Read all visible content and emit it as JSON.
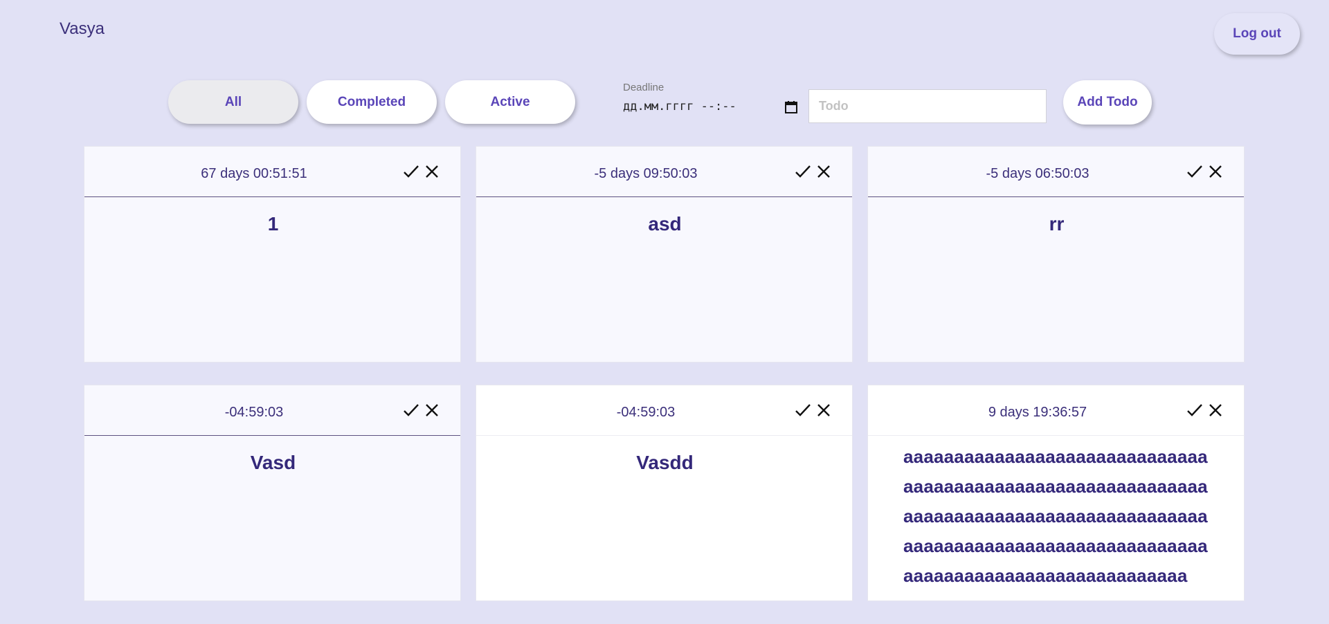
{
  "header": {
    "username": "Vasya",
    "logout_label": "Log out"
  },
  "filters": {
    "all": "All",
    "completed": "Completed",
    "active": "Active",
    "selected": "All"
  },
  "form": {
    "deadline_label": "Deadline",
    "deadline_value": "дд.мм.гггг --:--",
    "todo_placeholder": "Todo",
    "add_label": "Add Todo"
  },
  "todos": [
    {
      "timer": "67 days 00:51:51",
      "title": "1"
    },
    {
      "timer": "-5 days 09:50:03",
      "title": "asd"
    },
    {
      "timer": "-5 days 06:50:03",
      "title": "rr"
    },
    {
      "timer": "-04:59:03",
      "title": "Vasd"
    },
    {
      "timer": "-04:59:03",
      "title": "Vasdd"
    },
    {
      "timer": "9 days 19:36:57",
      "title": "aaaaaaaaaaaaaaaaaaaaaaaaaaaaaaaaaaaaaaaaaaaaaaaaaaaaaaaaaaaaaaaaaaaaaaaaaaaaaaaaaaaaaaaaaaaaaaaaaaaaaaaaaaaaaaaaaaaaaaaaaaaaaaaaaaaaaaaaaaaaaaaaaaaa"
    }
  ],
  "icons": {
    "complete": "check-icon",
    "delete": "x-icon",
    "calendar": "calendar-icon"
  },
  "colors": {
    "background": "#e1e1f5",
    "accent": "#5a45b8",
    "text": "#3b2f7a"
  }
}
